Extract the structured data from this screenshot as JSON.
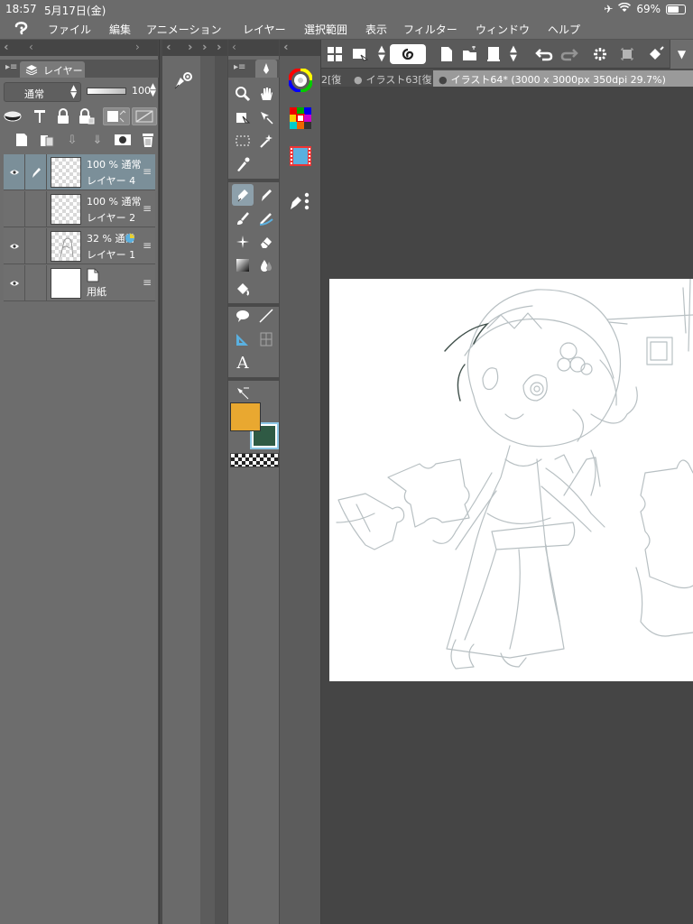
{
  "status_bar": {
    "time": "18:57",
    "date": "5月17日(金)",
    "battery": "69%",
    "battery_level": 0.69
  },
  "menu": {
    "items": [
      "ファイル",
      "編集",
      "アニメーション",
      "レイヤー",
      "選択範囲",
      "表示",
      "フィルター",
      "ウィンドウ",
      "ヘルプ"
    ]
  },
  "layer_panel": {
    "tab_label": "レイヤー",
    "blend_mode": "通常",
    "opacity": "100",
    "layers": [
      {
        "opacity_mode": "100 % 通常",
        "name": "レイヤー 4",
        "visible": true,
        "selected": true,
        "has_pen": true,
        "paper": false
      },
      {
        "opacity_mode": "100 % 通常",
        "name": "レイヤー 2",
        "visible": false,
        "selected": false,
        "has_pen": false,
        "paper": false
      },
      {
        "opacity_mode": "32 % 通常",
        "name": "レイヤー 1",
        "visible": true,
        "selected": false,
        "has_pen": false,
        "paper": false
      },
      {
        "opacity_mode": "",
        "name": "用紙",
        "visible": true,
        "selected": false,
        "has_pen": false,
        "paper": true
      }
    ]
  },
  "colors": {
    "main_color": "#e9a830",
    "sub_color": "#2f5a44",
    "selection_highlight": "#8da0ab"
  },
  "documents": {
    "tabs": [
      {
        "label": "2[復"
      },
      {
        "label": "イラスト63[復"
      },
      {
        "label": "イラスト64* (3000 x 3000px 350dpi 29.7%)"
      }
    ]
  }
}
